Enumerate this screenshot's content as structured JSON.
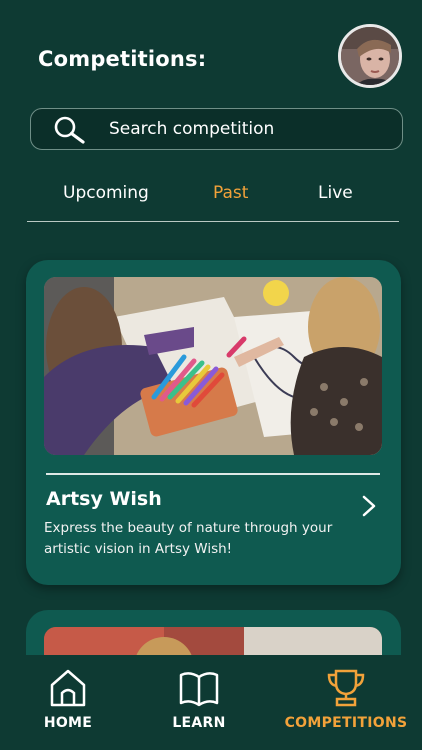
{
  "header": {
    "title": "Competitions:"
  },
  "search": {
    "placeholder": "Search competition"
  },
  "tabs": [
    {
      "label": "Upcoming",
      "active": false
    },
    {
      "label": "Past",
      "active": true
    },
    {
      "label": "Live",
      "active": false
    }
  ],
  "cards": [
    {
      "title": "Artsy Wish",
      "description": "Express the beauty of nature through your artistic vision in Artsy Wish!"
    }
  ],
  "nav": {
    "items": [
      {
        "label": "HOME",
        "icon": "home-icon",
        "active": false
      },
      {
        "label": "LEARN",
        "icon": "book-icon",
        "active": false
      },
      {
        "label": "COMPETITIONS",
        "icon": "trophy-icon",
        "active": true
      }
    ]
  },
  "colors": {
    "background": "#0e3a33",
    "card": "#0f5a50",
    "accent": "#f2a23a"
  }
}
